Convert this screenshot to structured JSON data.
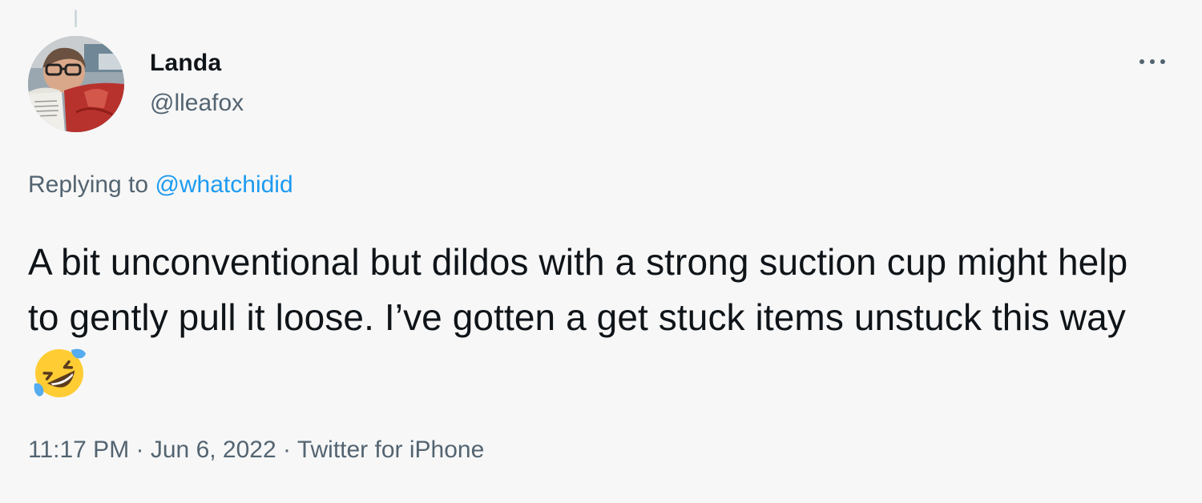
{
  "tweet": {
    "author": {
      "display_name": "Landa",
      "handle": "@lleafox"
    },
    "menu_icon": "more-horizontal-icon",
    "reply_context": {
      "prefix": "Replying to",
      "mention": "@whatchidid"
    },
    "text": "A bit unconventional but dildos with a strong suction cup might help to gently pull it loose. I’ve gotten a get stuck items unstuck this way",
    "emoji": "rolling-on-the-floor-laughing-emoji",
    "time": "11:17 PM",
    "separator": "·",
    "date": "Jun 6, 2022",
    "source": "Twitter for iPhone"
  },
  "colors": {
    "background": "#f7f7f7",
    "text_primary": "#0f1419",
    "text_secondary": "#536471",
    "link": "#1d9bf0"
  }
}
